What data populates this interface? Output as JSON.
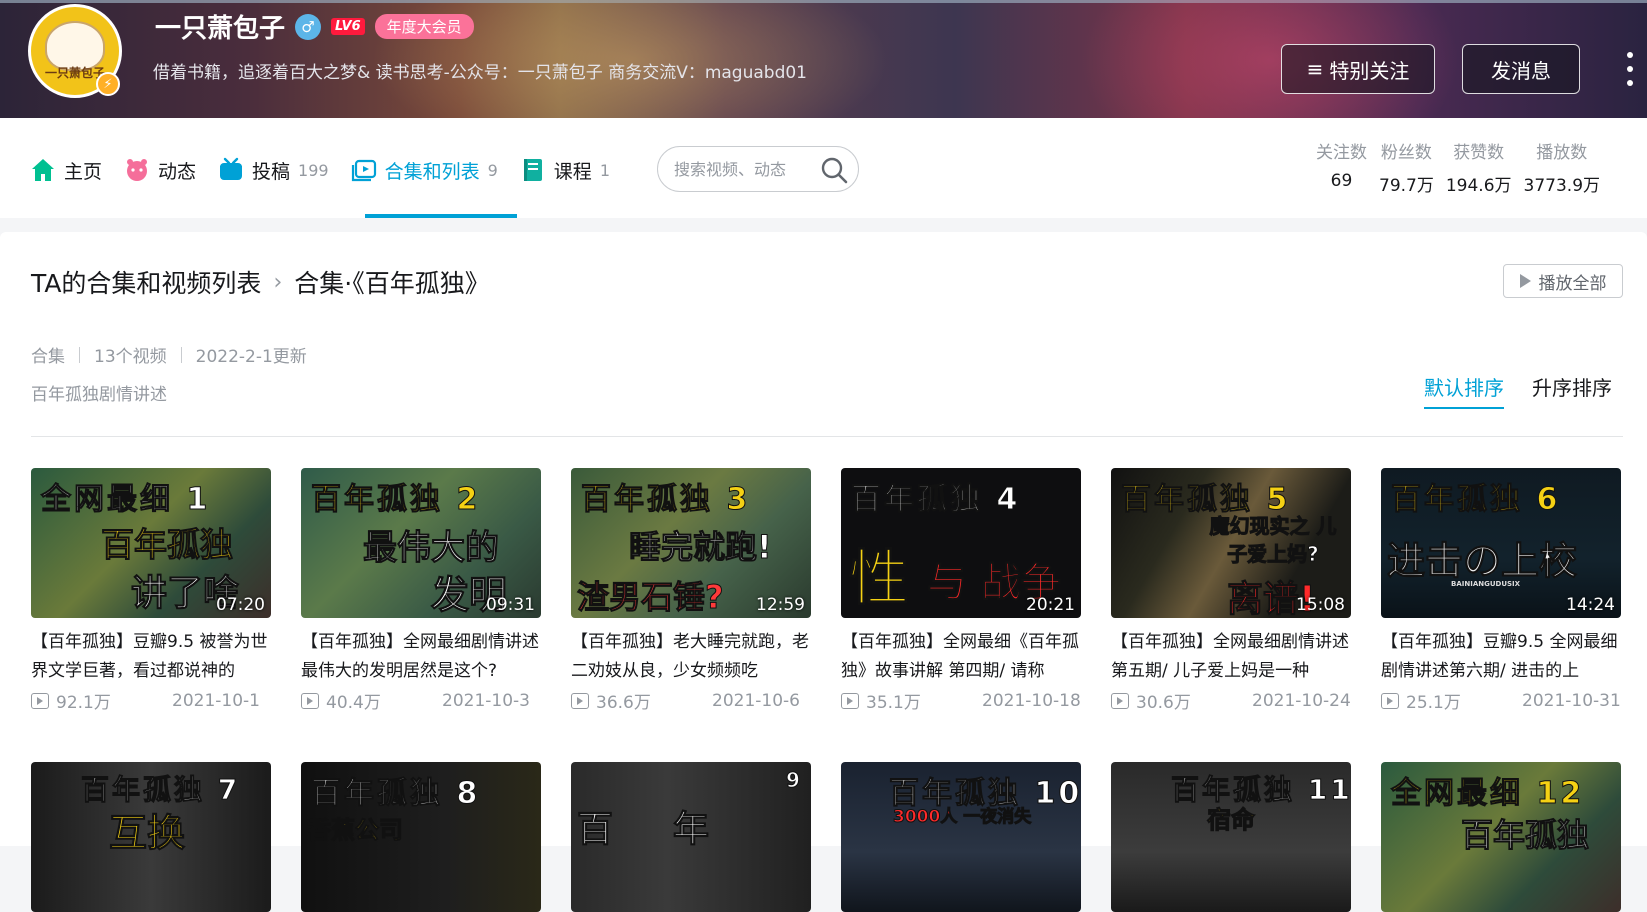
{
  "header": {
    "username": "一只萧包子",
    "gender_symbol": "♂",
    "level": "LV6",
    "vip_badge": "年度大会员",
    "signature": "借着书籍，追逐着百大之梦& 读书思考-公众号：一只萧包子 商务交流V：maguabd01",
    "avatar_text": "一只萧包子",
    "follow_button": "特别关注",
    "message_button": "发消息"
  },
  "nav": {
    "items": [
      {
        "label": "主页",
        "count": ""
      },
      {
        "label": "动态",
        "count": ""
      },
      {
        "label": "投稿",
        "count": "199"
      },
      {
        "label": "合集和列表",
        "count": "9"
      },
      {
        "label": "课程",
        "count": "1"
      }
    ],
    "active_index": 3,
    "search_placeholder": "搜索视频、动态"
  },
  "stats": [
    {
      "label": "关注数",
      "value": "69"
    },
    {
      "label": "粉丝数",
      "value": "79.7万"
    },
    {
      "label": "获赞数",
      "value": "194.6万"
    },
    {
      "label": "播放数",
      "value": "3773.9万"
    }
  ],
  "collection": {
    "breadcrumb_root": "TA的合集和视频列表",
    "breadcrumb_current": "合集·《百年孤独》",
    "play_all": "播放全部",
    "type": "合集",
    "video_count": "13个视频",
    "updated": "2022-2-1更新",
    "description": "百年孤独剧情讲述",
    "sort_default": "默认排序",
    "sort_asc": "升序排序"
  },
  "videos": [
    {
      "thumb_l1": "全网最细 1",
      "thumb_l2": "百年孤独",
      "thumb_l3": "讲了啥",
      "duration": "07:20",
      "title": "【百年孤独】豆瓣9.5 被誉为世界文学巨著，看过都说神的",
      "views": "92.1万",
      "date": "2021-10-1"
    },
    {
      "thumb_l1": "百年孤独 2",
      "thumb_l2": "最伟大的",
      "thumb_l3": "发明",
      "duration": "09:31",
      "title": "【百年孤独】全网最细剧情讲述 最伟大的发明居然是这个?",
      "views": "40.4万",
      "date": "2021-10-3"
    },
    {
      "thumb_l1": "百年孤独 3",
      "thumb_l2": "睡完就跑!",
      "thumb_l3": "渣男石锤?",
      "duration": "12:59",
      "title": "【百年孤独】老大睡完就跑，老二劝妓从良，少女频频吃",
      "views": "36.6万",
      "date": "2021-10-6"
    },
    {
      "thumb_l1": "百年孤独 4",
      "thumb_l2": "性",
      "thumb_l3": "与 战争",
      "duration": "20:21",
      "title": "【百年孤独】全网最细《百年孤独》故事讲解 第四期/ 请称",
      "views": "35.1万",
      "date": "2021-10-18"
    },
    {
      "thumb_l1": "百年孤独 5",
      "thumb_l2": "魔幻现实之 儿子爱上妈?",
      "thumb_l3": "离谱!",
      "duration": "15:08",
      "title": "【百年孤独】全网最细剧情讲述 第五期/ 儿子爱上妈是一种",
      "views": "30.6万",
      "date": "2021-10-24"
    },
    {
      "thumb_l1": "百年孤独 6",
      "thumb_l2": "进击の上校",
      "thumb_l3": "BAINIANGUDUSIX",
      "duration": "14:24",
      "title": "【百年孤独】豆瓣9.5 全网最细 剧情讲述第六期/ 进击的上",
      "views": "25.1万",
      "date": "2021-10-31"
    }
  ],
  "videos_row2": [
    {
      "thumb_l1": "百年孤独 7",
      "thumb_l2": "互换"
    },
    {
      "thumb_l1": "百年孤独 8",
      "thumb_l2": "香蕉公司"
    },
    {
      "thumb_l1": "9",
      "thumb_l2": "百年 孤独"
    },
    {
      "thumb_l1": "百年孤独 10",
      "thumb_l2": "3000人 一夜消失"
    },
    {
      "thumb_l1": "百年孤独 11",
      "thumb_l2": "宿命"
    },
    {
      "thumb_l1": "全网最细 12",
      "thumb_l2": "百年孤独"
    }
  ],
  "colors": {
    "accent": "#00a1d6",
    "vip": "#fb7299",
    "level": "#ff1a3d",
    "muted": "#9499a0"
  }
}
